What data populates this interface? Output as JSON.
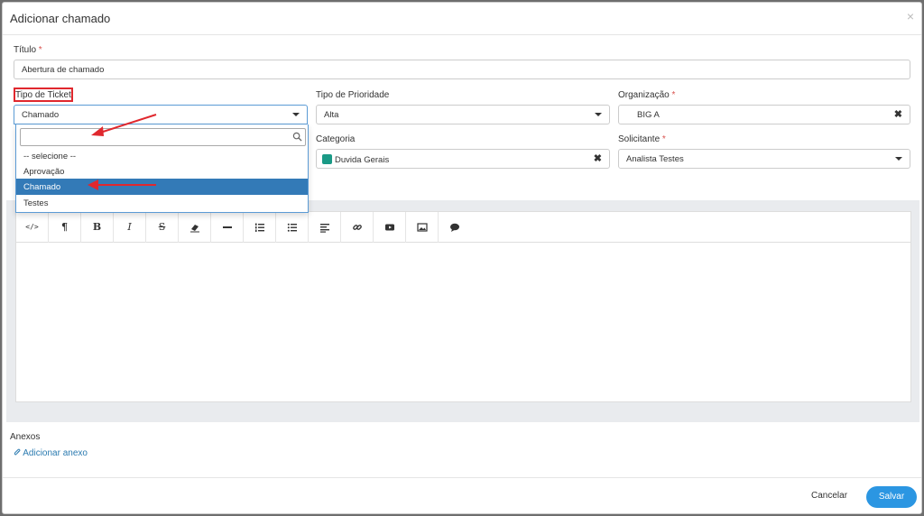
{
  "modal": {
    "title": "Adicionar chamado",
    "close_glyph": "×"
  },
  "fields": {
    "titulo": {
      "label": "Título",
      "required_mark": "*",
      "value": "Abertura de chamado"
    },
    "tipo_ticket": {
      "label": "Tipo de Ticket",
      "value": "Chamado",
      "search_value": "",
      "options": [
        "-- selecione --",
        "Aprovação",
        "Chamado",
        "Testes"
      ],
      "selected_option": "Chamado"
    },
    "tipo_prioridade": {
      "label": "Tipo de Prioridade",
      "value": "Alta"
    },
    "organizacao": {
      "label": "Organização",
      "required_mark": "*",
      "value": "BIG A",
      "clear_glyph": "✖"
    },
    "categoria": {
      "label": "Categoria",
      "value": "Duvida Gerais",
      "color": "#1a9a86",
      "clear_glyph": "✖"
    },
    "solicitante": {
      "label": "Solicitante",
      "required_mark": "*",
      "value": "Analista Testes"
    }
  },
  "editor": {
    "toolbar": [
      {
        "icon": "code-view-icon",
        "glyph": "</>"
      },
      {
        "icon": "paragraph-icon",
        "glyph": "¶"
      },
      {
        "icon": "bold-icon",
        "glyph": "B"
      },
      {
        "icon": "italic-icon",
        "glyph": "I"
      },
      {
        "icon": "strikethrough-icon",
        "glyph": "S"
      },
      {
        "icon": "eraser-icon",
        "glyph": ""
      },
      {
        "icon": "horizontal-rule-icon",
        "glyph": ""
      },
      {
        "icon": "ordered-list-icon",
        "glyph": ""
      },
      {
        "icon": "unordered-list-icon",
        "glyph": ""
      },
      {
        "icon": "align-icon",
        "glyph": ""
      },
      {
        "icon": "link-icon",
        "glyph": ""
      },
      {
        "icon": "video-icon",
        "glyph": ""
      },
      {
        "icon": "image-icon",
        "glyph": ""
      },
      {
        "icon": "comment-icon",
        "glyph": ""
      }
    ],
    "content": ""
  },
  "attachments": {
    "label": "Anexos",
    "add_link": "Adicionar anexo"
  },
  "footer": {
    "cancel_label": "Cancelar",
    "save_label": "Salvar"
  },
  "colors": {
    "accent": "#2b96e2",
    "selected_option": "#337ab7",
    "highlight": "#e0282e",
    "annotation_arrow": "#e0282e"
  }
}
